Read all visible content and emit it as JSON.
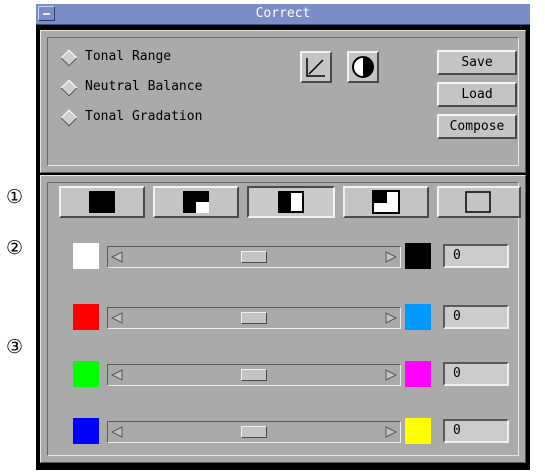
{
  "window": {
    "title": "Correct"
  },
  "callouts": [
    "①",
    "②",
    "③"
  ],
  "modes": [
    {
      "label": "Tonal Range",
      "selected": false
    },
    {
      "label": "Neutral Balance",
      "selected": false
    },
    {
      "label": "Tonal Gradation",
      "selected": false
    }
  ],
  "tools": [
    {
      "icon": "curve-icon"
    },
    {
      "icon": "contrast-icon"
    }
  ],
  "actions": {
    "save": "Save",
    "load": "Load",
    "compose": "Compose"
  },
  "zones": [
    {
      "icon": "shadows-zone-icon",
      "selected": false
    },
    {
      "icon": "three-quarter-tone-zone-icon",
      "selected": false
    },
    {
      "icon": "midtones-zone-icon",
      "selected": true
    },
    {
      "icon": "quarter-tone-zone-icon",
      "selected": false
    },
    {
      "icon": "highlights-zone-icon",
      "selected": false
    }
  ],
  "sliders": [
    {
      "left_color": "#ffffff",
      "right_color": "#000000",
      "value": "0",
      "position": 0.5
    },
    {
      "left_color": "#ff0000",
      "right_color": "#0099ff",
      "value": "0",
      "position": 0.5
    },
    {
      "left_color": "#00ff00",
      "right_color": "#ff00ff",
      "value": "0",
      "position": 0.5
    },
    {
      "left_color": "#0000ff",
      "right_color": "#ffff00",
      "value": "0",
      "position": 0.5
    }
  ]
}
